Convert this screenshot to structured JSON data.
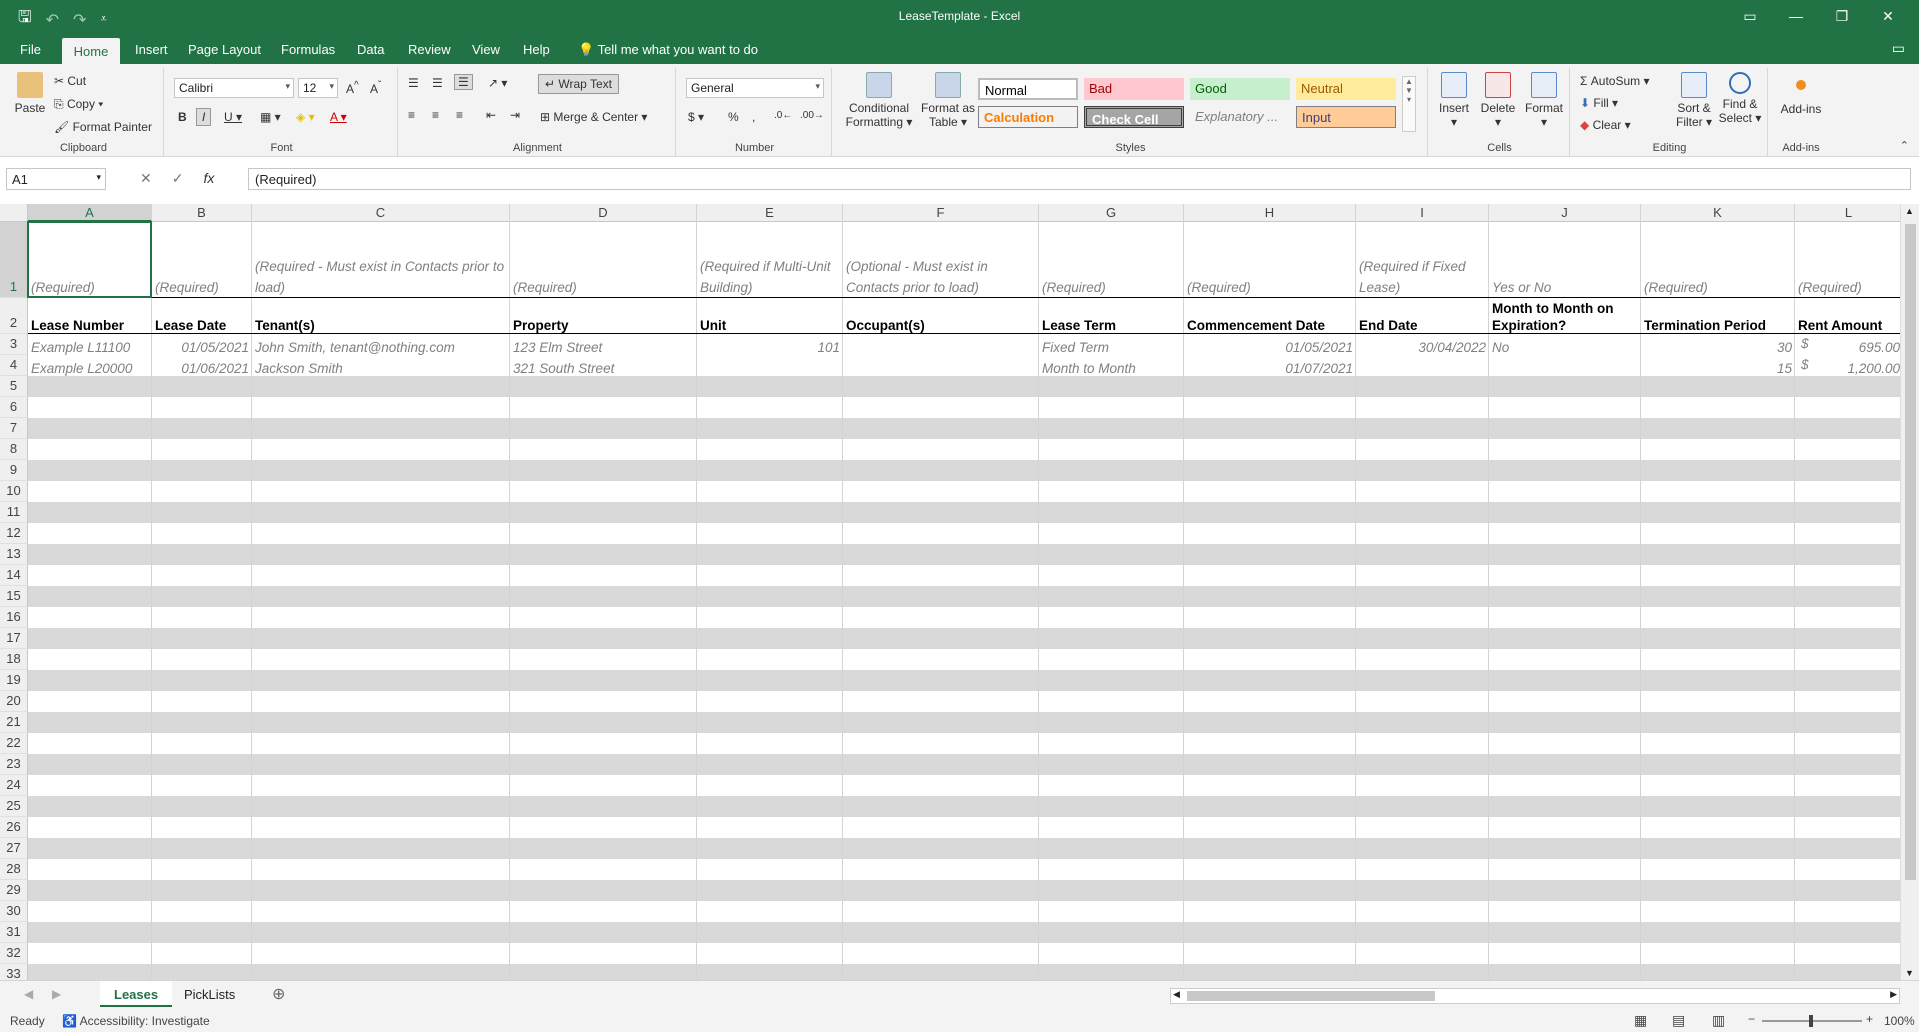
{
  "window": {
    "title": "LeaseTemplate - Excel"
  },
  "tabs": [
    "File",
    "Home",
    "Insert",
    "Page Layout",
    "Formulas",
    "Data",
    "Review",
    "View",
    "Help"
  ],
  "tell_me": "Tell me what you want to do",
  "ribbon": {
    "clipboard": {
      "label": "Clipboard",
      "paste": "Paste",
      "cut": "Cut",
      "copy": "Copy",
      "format_painter": "Format Painter"
    },
    "font": {
      "label": "Font",
      "name": "Calibri",
      "size": "12"
    },
    "alignment": {
      "label": "Alignment",
      "wrap_text": "Wrap Text",
      "merge_center": "Merge & Center"
    },
    "number": {
      "label": "Number",
      "format": "General"
    },
    "styles": {
      "label": "Styles",
      "conditional_formatting": [
        "Conditional",
        "Formatting"
      ],
      "format_as_table": [
        "Format as",
        "Table"
      ],
      "normal": "Normal",
      "bad": "Bad",
      "good": "Good",
      "neutral": "Neutral",
      "calculation": "Calculation",
      "check_cell": "Check Cell",
      "explanatory": "Explanatory ...",
      "input": "Input"
    },
    "cells": {
      "label": "Cells",
      "insert": "Insert",
      "delete": "Delete",
      "format": "Format"
    },
    "editing": {
      "label": "Editing",
      "autosum": "AutoSum",
      "fill": "Fill",
      "clear": "Clear",
      "sort_filter": [
        "Sort &",
        "Filter"
      ],
      "find_select": [
        "Find &",
        "Select"
      ]
    },
    "addins": {
      "label": "Add-ins",
      "addins": "Add-ins"
    }
  },
  "formula_bar": {
    "name_box": "A1",
    "formula": "(Required)"
  },
  "columns": [
    "A",
    "B",
    "C",
    "D",
    "E",
    "F",
    "G",
    "H",
    "I",
    "J",
    "K",
    "L"
  ],
  "rows": {
    "r1": [
      "(Required)",
      "(Required)",
      "(Required - Must exist in Contacts prior to load)",
      "(Required)",
      "(Required if Multi-Unit Building)",
      "(Optional - Must exist in Contacts prior to load)",
      "(Required)",
      "(Required)",
      "(Required if Fixed Lease)",
      "Yes or No",
      "(Required)",
      "(Required)"
    ],
    "r2": [
      "Lease Number",
      "Lease Date",
      "Tenant(s)",
      "Property",
      "Unit",
      "Occupant(s)",
      "Lease Term",
      "Commencement Date",
      "End Date",
      "Month to Month on Expiration?",
      "Termination Period",
      "Rent Amount"
    ],
    "r3": [
      "Example L11100",
      "01/05/2021",
      "John Smith, tenant@nothing.com",
      "123 Elm Street",
      "101",
      "",
      "Fixed Term",
      "01/05/2021",
      "30/04/2022",
      "No",
      "30",
      "695.00"
    ],
    "r4": [
      "Example L20000",
      "01/06/2021",
      "Jackson Smith",
      "321 South Street",
      "",
      "",
      "Month to Month",
      "01/07/2021",
      "",
      "",
      "15",
      "1,200.00"
    ]
  },
  "currency_symbol": "$",
  "row_numbers": [
    "1",
    "2",
    "3",
    "4",
    "5",
    "6",
    "7",
    "8",
    "9",
    "10",
    "11",
    "12",
    "13",
    "14",
    "15",
    "16",
    "17",
    "18",
    "19",
    "20",
    "21",
    "22",
    "23",
    "24",
    "25",
    "26",
    "27",
    "28",
    "29",
    "30",
    "31",
    "32",
    "33"
  ],
  "sheets": [
    "Leases",
    "PickLists"
  ],
  "status": {
    "ready": "Ready",
    "accessibility": "Accessibility: Investigate",
    "zoom": "100%"
  },
  "colors": {
    "brand": "#217346",
    "band": "#d9d9d9"
  }
}
